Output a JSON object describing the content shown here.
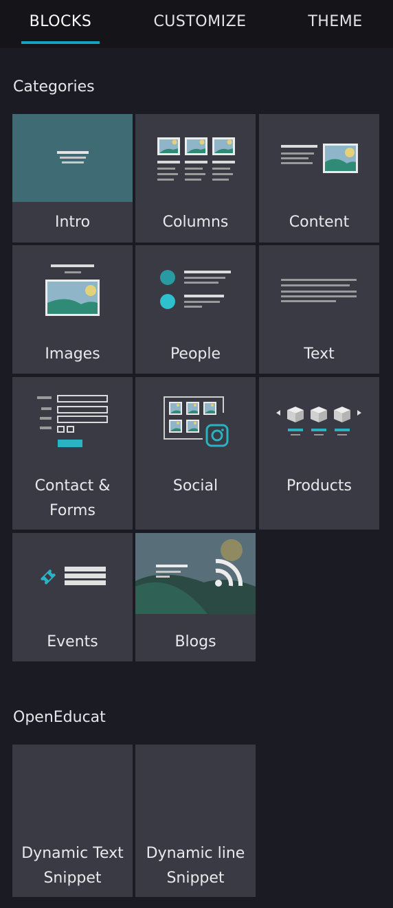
{
  "tabs": [
    {
      "label": "BLOCKS",
      "active": true
    },
    {
      "label": "CUSTOMIZE",
      "active": false
    },
    {
      "label": "THEME",
      "active": false
    }
  ],
  "sections": {
    "categories": {
      "title": "Categories",
      "items": [
        {
          "label": "Intro",
          "icon": "intro-icon"
        },
        {
          "label": "Columns",
          "icon": "columns-icon"
        },
        {
          "label": "Content",
          "icon": "content-icon"
        },
        {
          "label": "Images",
          "icon": "images-icon"
        },
        {
          "label": "People",
          "icon": "people-icon"
        },
        {
          "label": "Text",
          "icon": "text-icon"
        },
        {
          "label": "Contact &",
          "label2": "Forms",
          "icon": "contact-forms-icon"
        },
        {
          "label": "Social",
          "icon": "social-icon"
        },
        {
          "label": "Products",
          "icon": "products-icon"
        },
        {
          "label": "Events",
          "icon": "events-icon"
        },
        {
          "label": "Blogs",
          "icon": "blogs-icon"
        }
      ]
    },
    "openeducat": {
      "title": "OpenEducat",
      "items": [
        {
          "label": "Dynamic Text",
          "label2": "Snippet"
        },
        {
          "label": "Dynamic line",
          "label2": "Snippet"
        }
      ]
    }
  },
  "colors": {
    "accent": "#17a3bf",
    "panel_bg": "#1b1b23",
    "tile_bg": "#3a3a44",
    "header_bg": "#141419"
  }
}
